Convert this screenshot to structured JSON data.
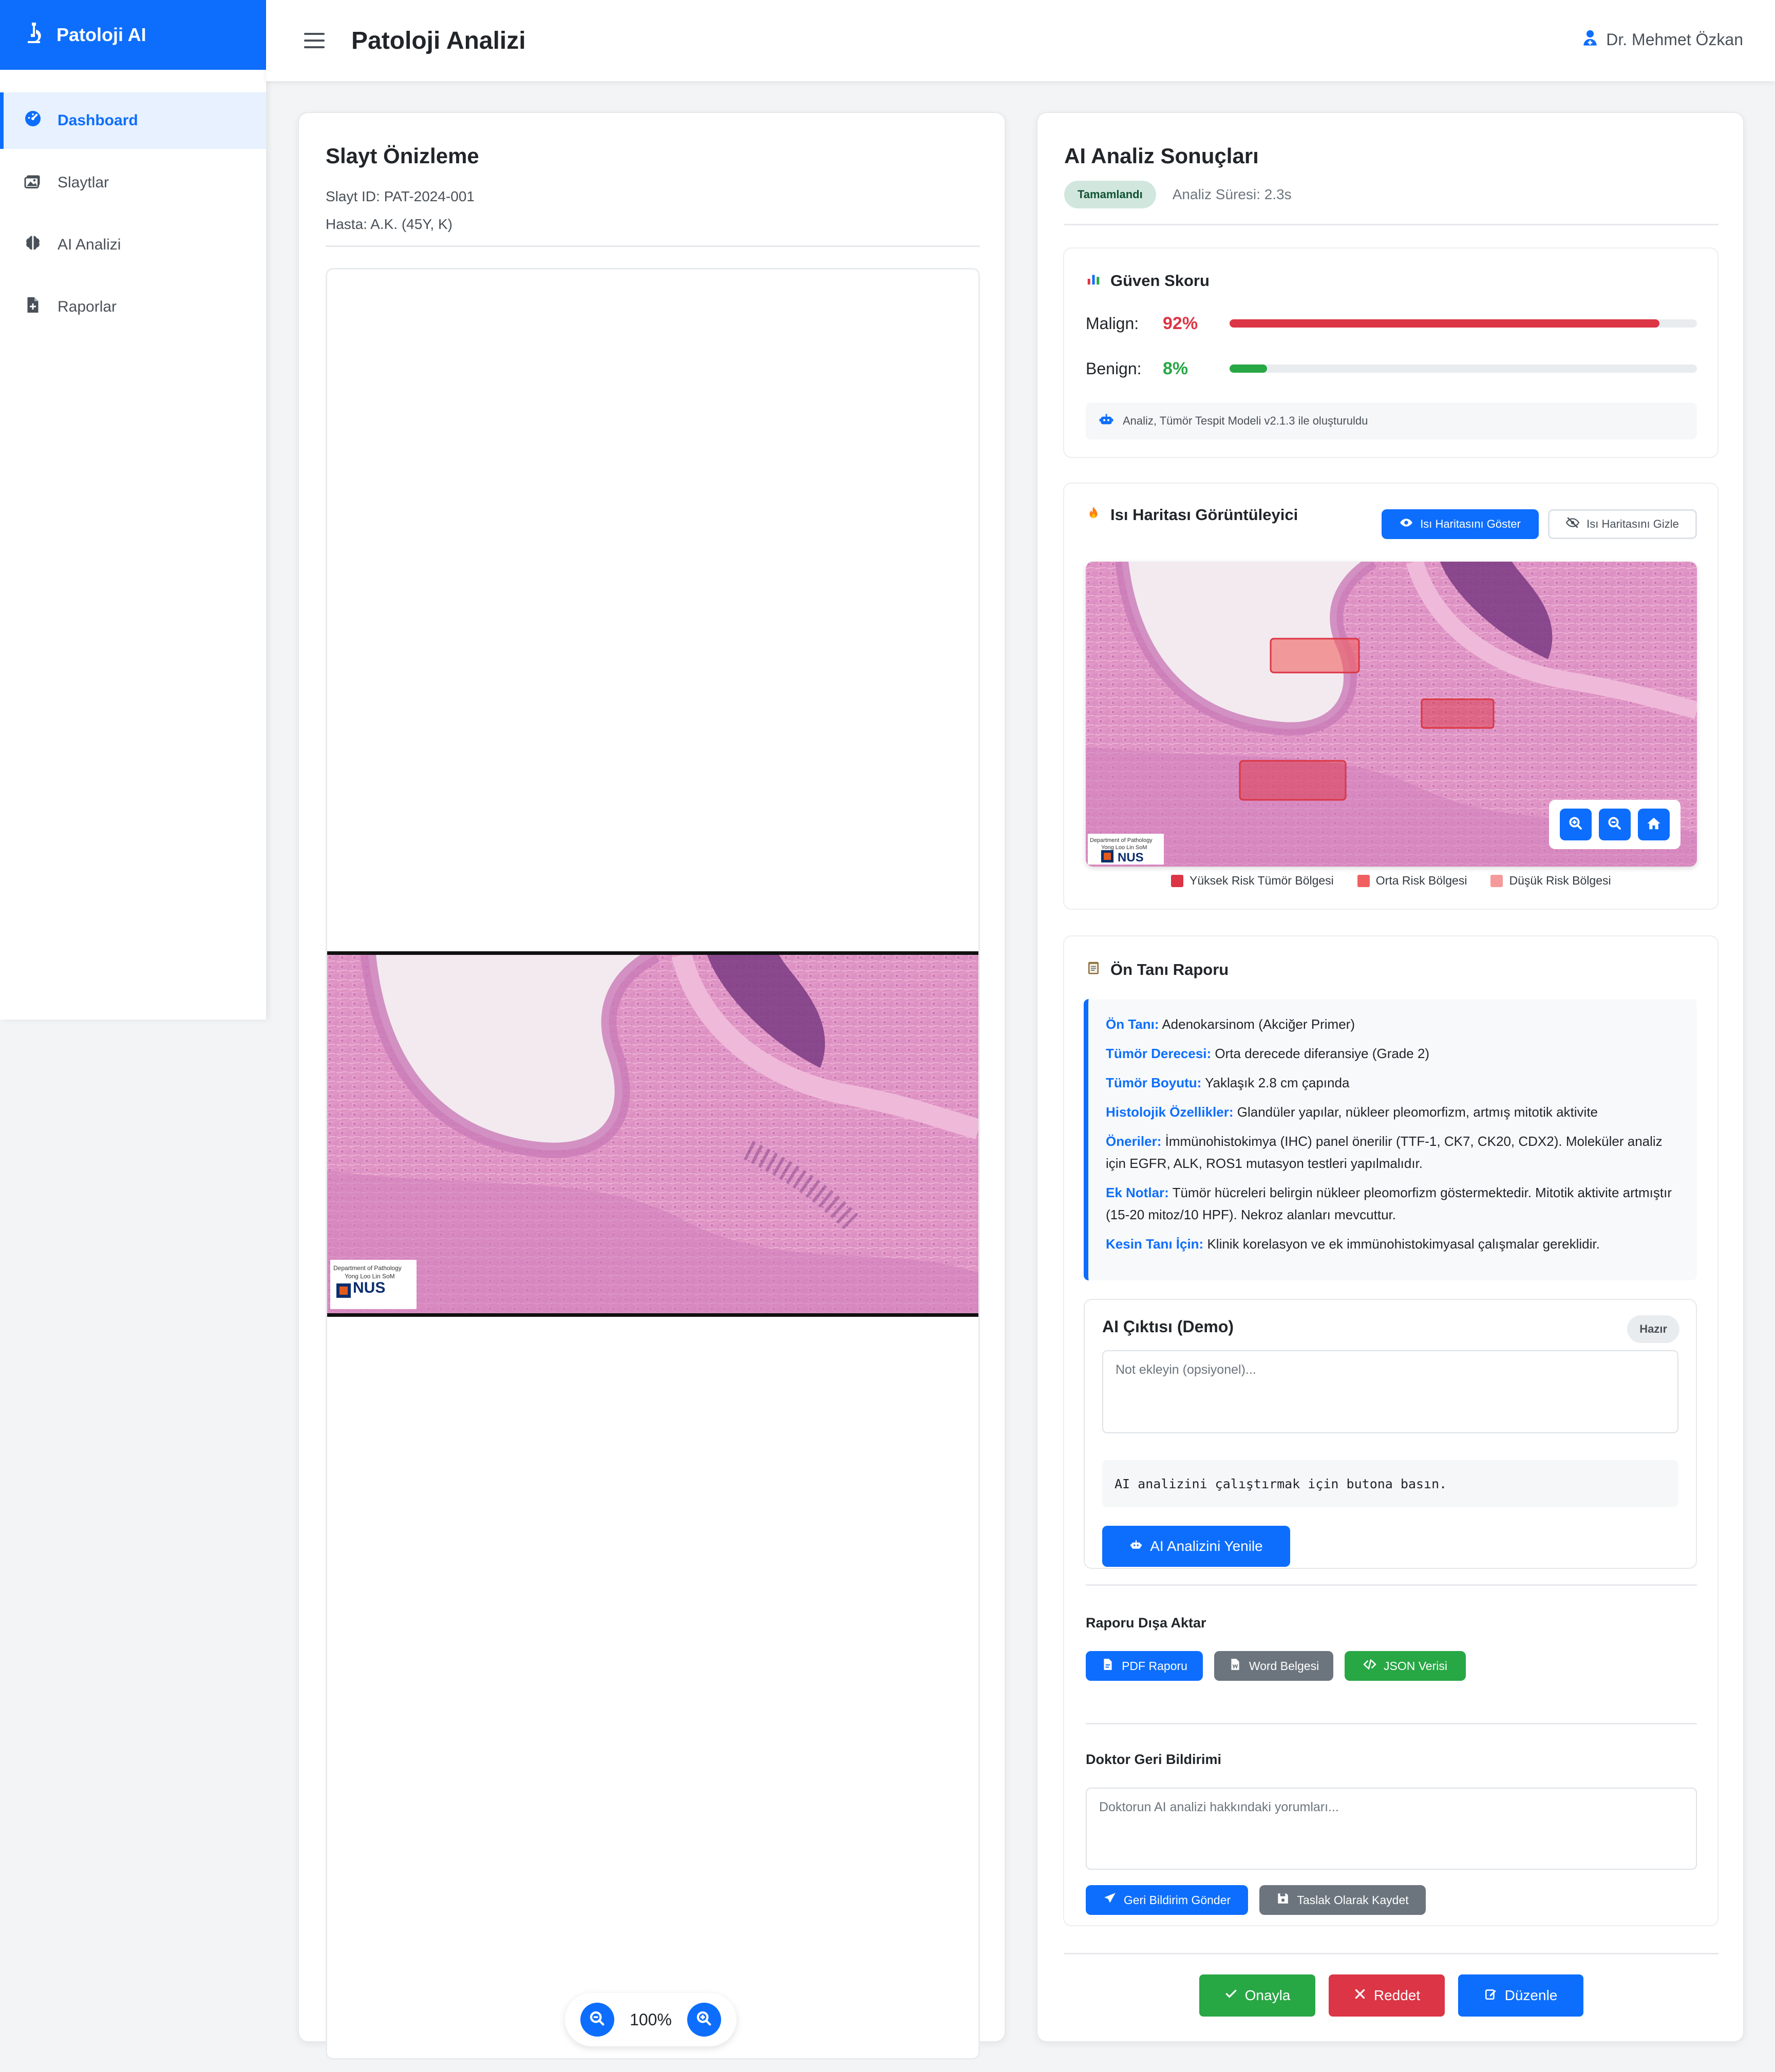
{
  "app": {
    "name": "Patoloji AI"
  },
  "sidebar": {
    "items": [
      {
        "label": "Dashboard",
        "icon": "gauge-icon"
      },
      {
        "label": "Slaytlar",
        "icon": "images-icon"
      },
      {
        "label": "AI Analizi",
        "icon": "brain-icon"
      },
      {
        "label": "Raporlar",
        "icon": "file-medical-icon"
      }
    ]
  },
  "header": {
    "title": "Patoloji Analizi",
    "user": "Dr. Mehmet Özkan"
  },
  "preview": {
    "title": "Slayt Önizleme",
    "slide_id": "Slayt ID: PAT-2024-001",
    "patient": "Hasta: A.K. (45Y, K)",
    "zoom": "100%",
    "watermark": "Department of Pathology Yong Loo Lin SoM NUS"
  },
  "results": {
    "title": "AI Analiz Sonuçları",
    "status": "Tamamlandı",
    "duration": "Analiz Süresi: 2.3s"
  },
  "confidence": {
    "title": "Güven Skoru",
    "malign_label": "Malign:",
    "malign_pct": "92%",
    "malign_value": 0.92,
    "benign_label": "Benign:",
    "benign_pct": "8%",
    "benign_value": 0.08,
    "model_note": "Analiz, Tümör Tespit Modeli v2.1.3 ile oluşturuldu"
  },
  "heatmap": {
    "title": "Isı Haritası Görüntüleyici",
    "show_label": "Isı Haritasını Göster",
    "hide_label": "Isı Haritasını Gizle",
    "legend": [
      {
        "label": "Yüksek Risk Tümör Bölgesi",
        "color": "#dc3545"
      },
      {
        "label": "Orta Risk Bölgesi",
        "color": "#f06060"
      },
      {
        "label": "Düşük Risk Bölgesi",
        "color": "#f59a9a"
      }
    ]
  },
  "report": {
    "title": "Ön Tanı Raporu",
    "lines": [
      {
        "key": "Ön Tanı:",
        "value": "Adenokarsinom (Akciğer Primer)"
      },
      {
        "key": "Tümör Derecesi:",
        "value": "Orta derecede diferansiye (Grade 2)"
      },
      {
        "key": "Tümör Boyutu:",
        "value": "Yaklaşık 2.8 cm çapında"
      },
      {
        "key": "Histolojik Özellikler:",
        "value": "Glandüler yapılar, nükleer pleomorfizm, artmış mitotik aktivite"
      },
      {
        "key": "Öneriler:",
        "value": "İmmünohistokimya (IHC) panel önerilir (TTF-1, CK7, CK20, CDX2). Moleküler analiz için EGFR, ALK, ROS1 mutasyon testleri yapılmalıdır."
      },
      {
        "key": "Ek Notlar:",
        "value": "Tümör hücreleri belirgin nükleer pleomorfizm göstermektedir. Mitotik aktivite artmıştır (15-20 mitoz/10 HPF). Nekroz alanları mevcuttur."
      },
      {
        "key": "Kesin Tanı İçin:",
        "value": "Klinik korelasyon ve ek immünohistokimyasal çalışmalar gereklidir."
      }
    ]
  },
  "ai_output": {
    "title": "AI Çıktısı (Demo)",
    "badge": "Hazır",
    "note_placeholder": "Not ekleyin (opsiyonel)...",
    "output_text": "AI analizini çalıştırmak için butona basın.",
    "refresh_label": "AI Analizini Yenile"
  },
  "export": {
    "title": "Raporu Dışa Aktar",
    "pdf": "PDF Raporu",
    "word": "Word Belgesi",
    "json": "JSON Verisi"
  },
  "feedback": {
    "title": "Doktor Geri Bildirimi",
    "placeholder": "Doktorun AI analizi hakkındaki yorumları...",
    "send": "Geri Bildirim Gönder",
    "draft": "Taslak Olarak Kaydet"
  },
  "actions": {
    "approve": "Onayla",
    "reject": "Reddet",
    "edit": "Düzenle"
  }
}
